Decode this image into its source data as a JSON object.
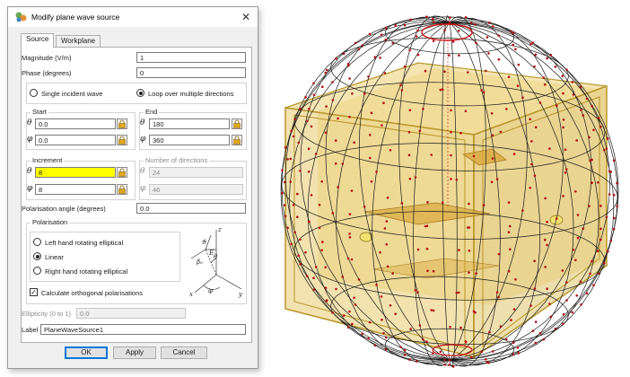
{
  "dialog": {
    "title": "Modify plane wave source",
    "close_symbol": "✕",
    "tabs": [
      {
        "label": "Source"
      },
      {
        "label": "Workplane"
      }
    ],
    "magnitude": {
      "label": "Magnitude (V/m)",
      "value": "1"
    },
    "phase": {
      "label": "Phase (degrees)",
      "value": "0"
    },
    "incidence": {
      "option_single": "Single incident wave",
      "option_loop": "Loop over multiple directions",
      "selected": "loop"
    },
    "start": {
      "label": "Start",
      "theta": "0.0",
      "phi": "0.0"
    },
    "end": {
      "label": "End",
      "theta": "180",
      "phi": "360"
    },
    "increment": {
      "label": "Increment",
      "theta": "8",
      "phi": "8"
    },
    "num_directions": {
      "label": "Number of directions",
      "theta": "24",
      "phi": "46"
    },
    "symbols": {
      "theta": "θ",
      "phi": "φ"
    },
    "polarisation_angle": {
      "label": "Polarisation angle (degrees)",
      "value": "0.0"
    },
    "polarisation": {
      "label": "Polarisation",
      "options": [
        "Left hand rotating elliptical",
        "Linear",
        "Right hand rotating elliptical"
      ],
      "selected_index": 1,
      "orthogonal_label": "Calculate orthogonal polarisations",
      "orthogonal_checked": true
    },
    "ellipticity": {
      "label": "Ellipticity (0 to 1)",
      "value": "0.0"
    },
    "label_field": {
      "label": "Label",
      "value": "PlaneWaveSource1"
    },
    "buttons": {
      "ok": "OK",
      "apply": "Apply",
      "cancel": "Cancel"
    }
  },
  "viewport": {
    "description_icon": "3d-geometry-view",
    "colors": {
      "box_fill": "#e8c96a",
      "box_edge": "#b8962a",
      "points": "#b01010",
      "circle": "#d01010"
    }
  }
}
